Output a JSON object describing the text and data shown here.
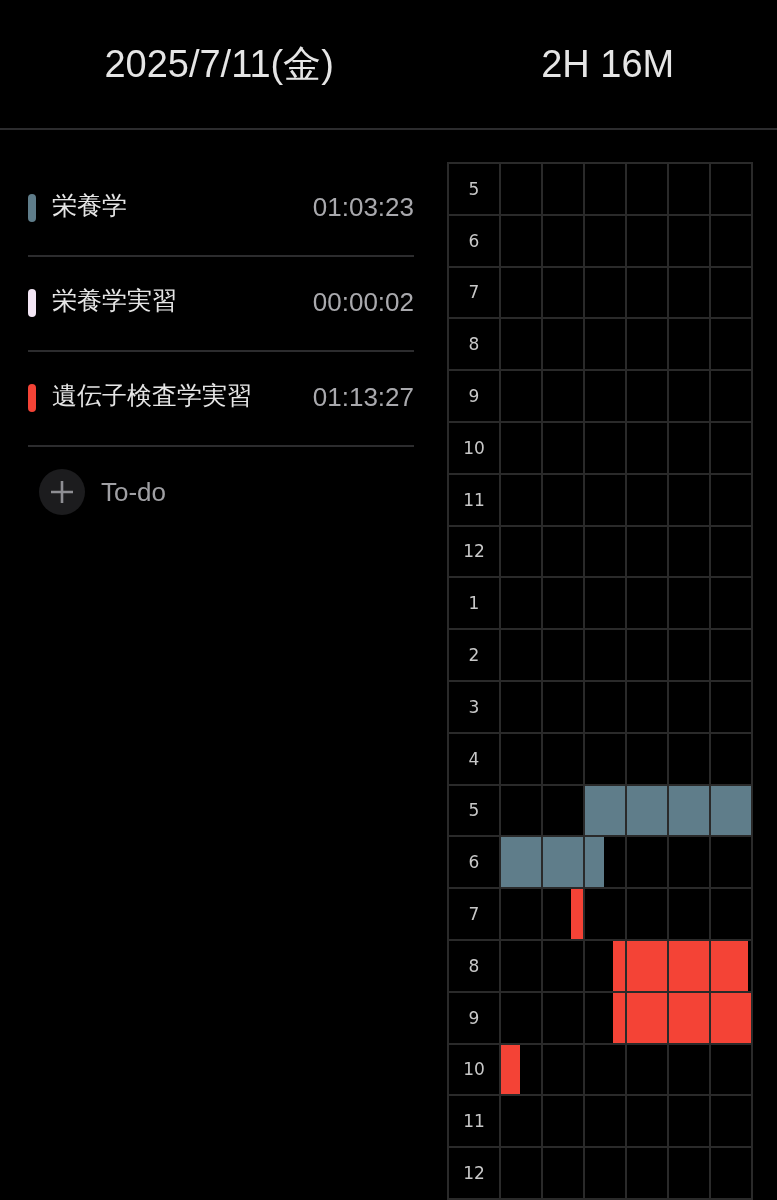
{
  "header": {
    "date": "2025/7/11(金)",
    "total": "2H 16M"
  },
  "subjects": [
    {
      "name": "栄養学",
      "time": "01:03:23",
      "color": "#5f7d8a"
    },
    {
      "name": "栄養学実習",
      "time": "00:00:02",
      "color": "#f3e6f5"
    },
    {
      "name": "遺伝子検査学実習",
      "time": "01:13:27",
      "color": "#f44336"
    }
  ],
  "todo_button": {
    "label": "To-do"
  },
  "timeline": {
    "rows": [
      {
        "hour": "5"
      },
      {
        "hour": "6"
      },
      {
        "hour": "7"
      },
      {
        "hour": "8"
      },
      {
        "hour": "9"
      },
      {
        "hour": "10"
      },
      {
        "hour": "11"
      },
      {
        "hour": "12"
      },
      {
        "hour": "1"
      },
      {
        "hour": "2"
      },
      {
        "hour": "3"
      },
      {
        "hour": "4"
      },
      {
        "hour": "5",
        "cells": [
          {},
          {},
          {
            "kind": "full",
            "color": "#5f7d8a"
          },
          {
            "kind": "full",
            "color": "#5f7d8a"
          },
          {
            "kind": "full",
            "color": "#5f7d8a"
          },
          {
            "kind": "full",
            "color": "#5f7d8a"
          }
        ]
      },
      {
        "hour": "6",
        "cells": [
          {
            "kind": "full",
            "color": "#5f7d8a"
          },
          {
            "kind": "full",
            "color": "#5f7d8a"
          },
          {
            "kind": "left-half",
            "color": "#5f7d8a"
          },
          {},
          {},
          {}
        ]
      },
      {
        "hour": "7",
        "cells": [
          {},
          {
            "kind": "right-third",
            "color": "#f44336"
          },
          {},
          {},
          {},
          {}
        ]
      },
      {
        "hour": "8",
        "cells": [
          {},
          {},
          {
            "kind": "right-third",
            "color": "#f44336"
          },
          {
            "kind": "full",
            "color": "#f44336"
          },
          {
            "kind": "full",
            "color": "#f44336"
          },
          {
            "kind": "left-most",
            "color": "#f44336"
          }
        ]
      },
      {
        "hour": "9",
        "cells": [
          {},
          {},
          {
            "kind": "right-third",
            "color": "#f44336"
          },
          {
            "kind": "full",
            "color": "#f44336"
          },
          {
            "kind": "full",
            "color": "#f44336"
          },
          {
            "kind": "full",
            "color": "#f44336"
          }
        ]
      },
      {
        "hour": "10",
        "cells": [
          {
            "kind": "left-half",
            "color": "#f44336"
          },
          {},
          {},
          {},
          {},
          {}
        ]
      },
      {
        "hour": "11"
      },
      {
        "hour": "12"
      }
    ]
  }
}
